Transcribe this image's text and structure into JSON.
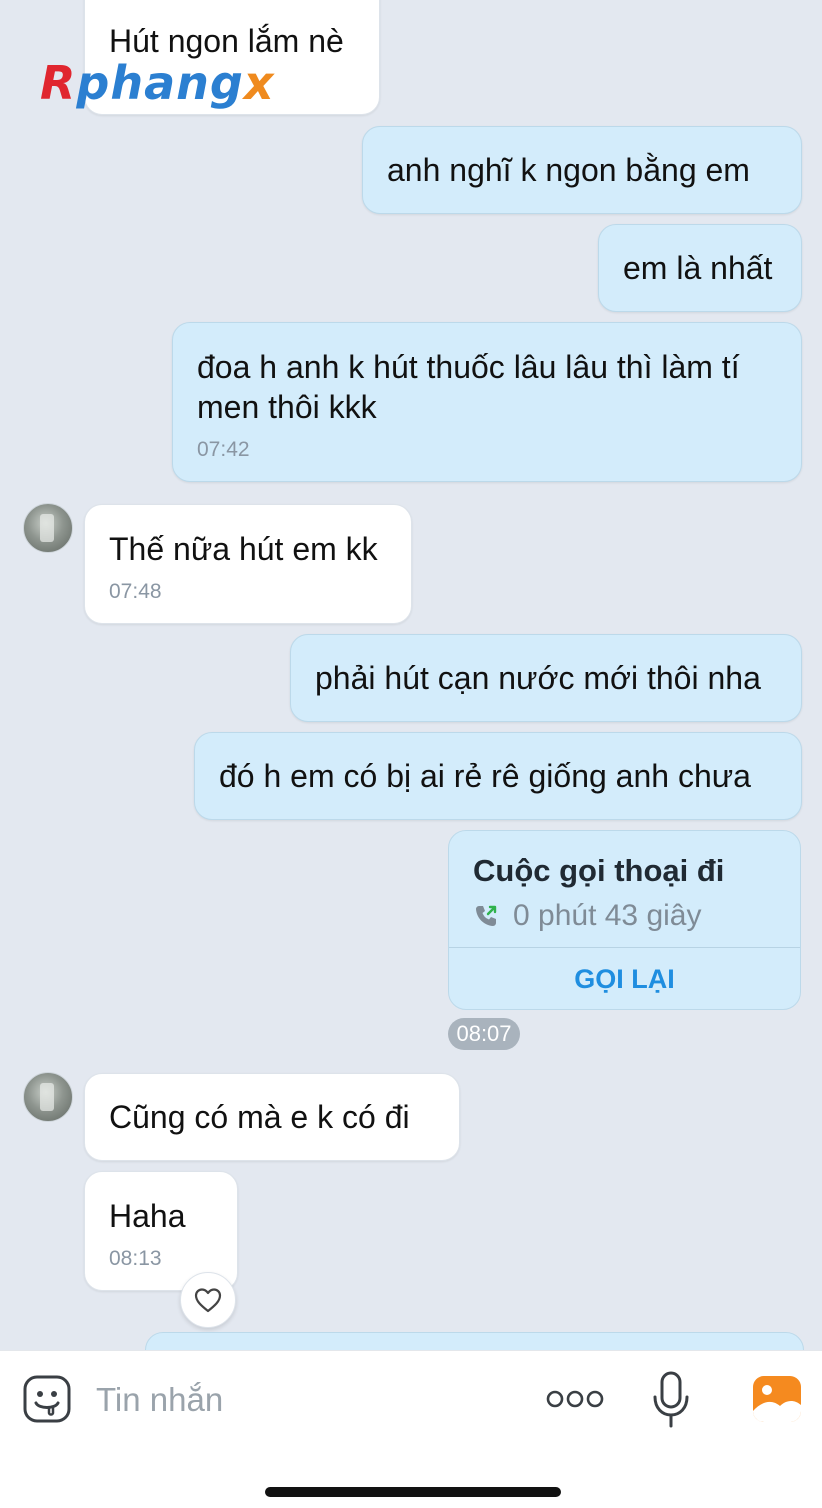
{
  "watermark": {
    "part1": "R",
    "part2": "phang",
    "part3": "x"
  },
  "messages": {
    "m1": {
      "text": "Hút ngon lắm nè"
    },
    "m2": {
      "text": "anh nghĩ k ngon bằng em"
    },
    "m3": {
      "text": "em là nhất"
    },
    "m4": {
      "text": "đoa h anh k hút thuốc lâu lâu thì làm tí men thôi kkk",
      "time": "07:42"
    },
    "m5": {
      "text": "Thế nữa hút em kk",
      "time": "07:48"
    },
    "m6": {
      "text": "phải hút cạn nước mới thôi nha"
    },
    "m7": {
      "text": "đó h em có bị ai rẻ rê giống anh chưa"
    },
    "m8": {
      "text": "Cũng có mà e k có đi"
    },
    "m9": {
      "text": "Haha",
      "time": "08:13"
    }
  },
  "call": {
    "title": "Cuộc gọi thoại đi",
    "duration": "0 phút 43 giây",
    "recall_label": "GỌI LẠI",
    "time": "08:07",
    "icon": "outgoing-call-icon",
    "accent_color": "#1f8ee0"
  },
  "composer": {
    "placeholder": "Tin nhắn",
    "icons": [
      "emoji-icon",
      "more-icon",
      "microphone-icon",
      "image-icon"
    ]
  },
  "colors": {
    "background": "#e3e8f0",
    "incoming_bubble": "#ffffff",
    "outgoing_bubble": "#d3ecfb"
  }
}
